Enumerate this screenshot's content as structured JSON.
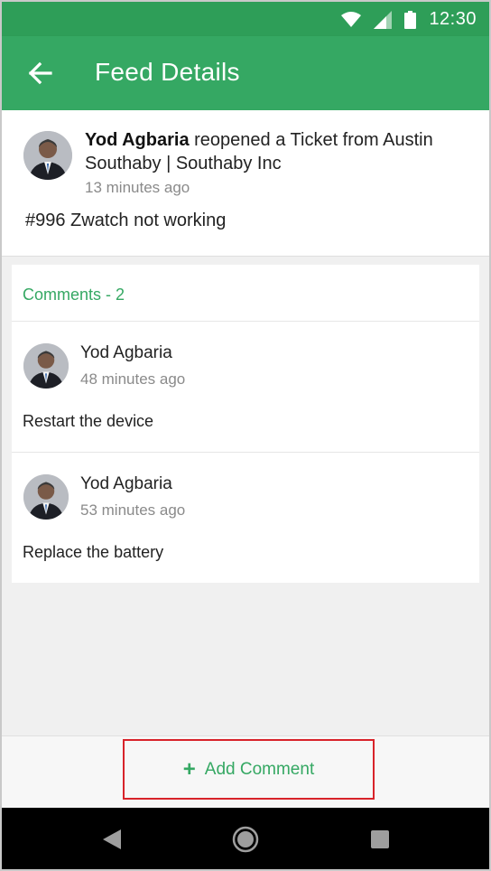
{
  "status_bar": {
    "time": "12:30",
    "icons": [
      "wifi-icon",
      "signal-icon",
      "battery-icon"
    ]
  },
  "app_bar": {
    "title": "Feed Details",
    "back_icon": "arrow-left-icon"
  },
  "feed": {
    "author": "Yod Agbaria",
    "action": " reopened a Ticket from Austin Southaby | Southaby Inc",
    "time": "13 minutes ago",
    "ticket": "#996 Zwatch not working"
  },
  "comments": {
    "title": "Comments - 2",
    "items": [
      {
        "author": "Yod Agbaria",
        "time": "48 minutes ago",
        "text": "Restart the device"
      },
      {
        "author": "Yod Agbaria",
        "time": "53 minutes ago",
        "text": "Replace the battery"
      }
    ]
  },
  "bottom": {
    "add_comment_icon": "plus-icon",
    "add_comment_label": "Add Comment"
  },
  "nav_bar": {
    "icons": [
      "nav-back-icon",
      "nav-home-icon",
      "nav-recents-icon"
    ]
  },
  "colors": {
    "primary": "#35a863",
    "status_bar": "#2e9e58",
    "highlight_border": "#d8232a"
  }
}
